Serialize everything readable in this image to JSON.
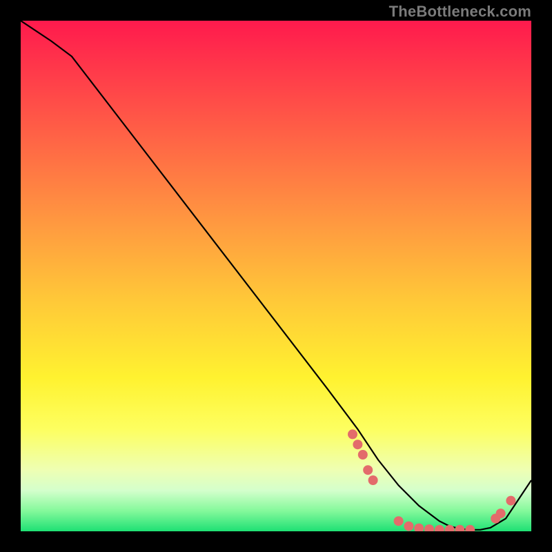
{
  "watermark": {
    "text": "TheBottleneck.com"
  },
  "chart_data": {
    "type": "line",
    "title": "",
    "xlabel": "",
    "ylabel": "",
    "xlim": [
      0,
      100
    ],
    "ylim": [
      0,
      100
    ],
    "series": [
      {
        "name": "bottleneck-curve",
        "x": [
          0,
          6,
          10,
          20,
          30,
          40,
          50,
          60,
          66,
          70,
          74,
          78,
          82,
          84,
          86,
          88,
          90,
          92,
          95,
          100
        ],
        "y": [
          100,
          96,
          93,
          80,
          67,
          54,
          41,
          28,
          20,
          14,
          9,
          5,
          2,
          1,
          0.5,
          0.3,
          0.3,
          0.7,
          2.5,
          10
        ]
      }
    ],
    "markers": [
      {
        "x": 65,
        "y": 19
      },
      {
        "x": 66,
        "y": 17
      },
      {
        "x": 67,
        "y": 15
      },
      {
        "x": 68,
        "y": 12
      },
      {
        "x": 69,
        "y": 10
      },
      {
        "x": 74,
        "y": 2
      },
      {
        "x": 76,
        "y": 1
      },
      {
        "x": 78,
        "y": 0.6
      },
      {
        "x": 80,
        "y": 0.4
      },
      {
        "x": 82,
        "y": 0.3
      },
      {
        "x": 84,
        "y": 0.3
      },
      {
        "x": 86,
        "y": 0.3
      },
      {
        "x": 88,
        "y": 0.3
      },
      {
        "x": 93,
        "y": 2.5
      },
      {
        "x": 94,
        "y": 3.5
      },
      {
        "x": 96,
        "y": 6
      }
    ],
    "marker_color": "#e36b6b",
    "line_color": "#000000"
  }
}
